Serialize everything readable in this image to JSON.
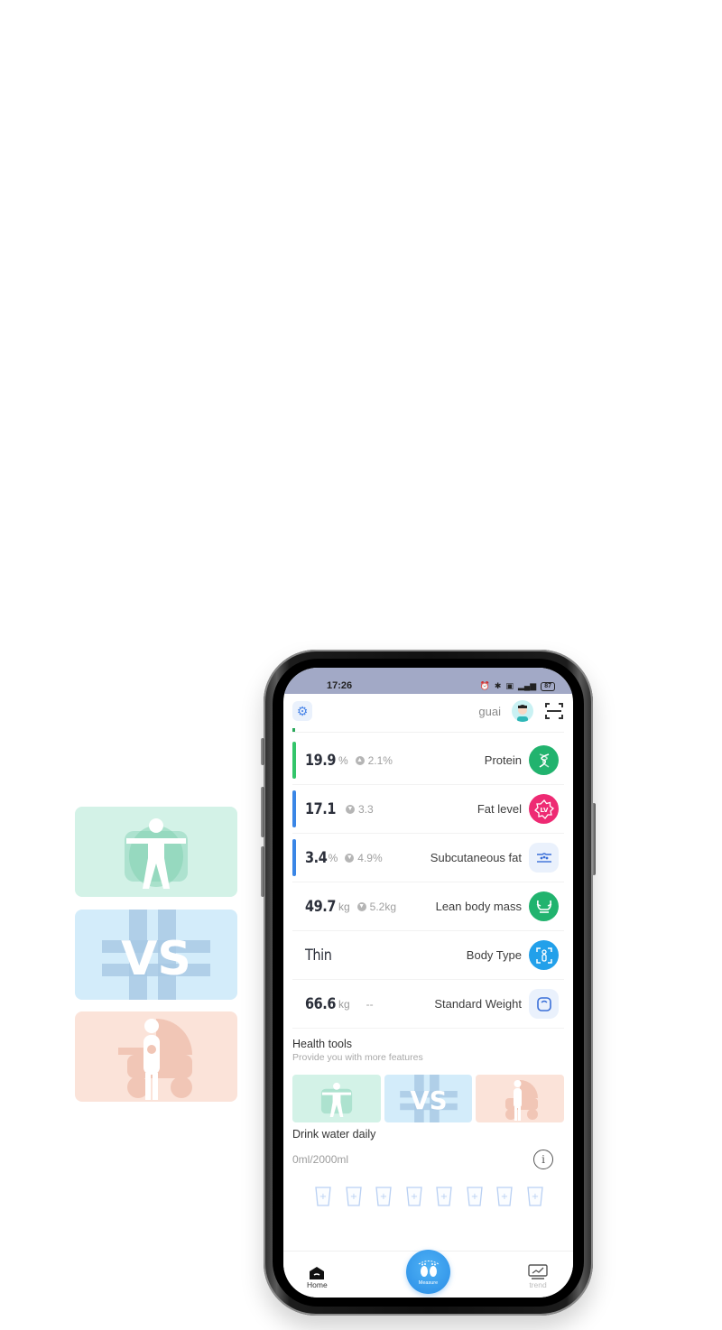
{
  "promo_cards": [
    {
      "name": "body-figure",
      "label": "Body"
    },
    {
      "name": "vs-compare",
      "label": "VS"
    },
    {
      "name": "baby-stroller",
      "label": "Baby"
    }
  ],
  "status_bar": {
    "time": "17:26",
    "icons": [
      "alarm-icon",
      "bluetooth-icon",
      "hd-icon",
      "signal-icon"
    ],
    "battery": "87"
  },
  "top_bar": {
    "settings_icon": "gear-icon",
    "username": "guai",
    "avatar_icon": "avatar",
    "scan_icon": "scan-icon"
  },
  "metrics": [
    {
      "value": "19.9",
      "unit": "%",
      "delta_dir": "up",
      "delta": "2.1%",
      "label": "Protein",
      "icon": "dna-icon",
      "icon_color": "#21b36e",
      "bar_color": "#33c56a"
    },
    {
      "value": "17.1",
      "unit": "",
      "delta_dir": "down",
      "delta": "3.3",
      "label": "Fat level",
      "icon": "lv-badge-icon",
      "icon_color": "#ee2a73",
      "bar_color": "#3a86e6"
    },
    {
      "value": "3.4",
      "unit": "%",
      "delta_dir": "down",
      "delta": "4.9%",
      "label": "Subcutaneous fat",
      "icon": "subcutaneous-fat-icon",
      "icon_color": "#eaf1fc",
      "bar_color": "#3a86e6"
    },
    {
      "value": "49.7",
      "unit": "kg",
      "delta_dir": "down",
      "delta": "5.2kg",
      "label": "Lean body mass",
      "icon": "muscle-icon",
      "icon_color": "#21b36e",
      "bar_color": ""
    },
    {
      "value": "Thin",
      "unit": "",
      "delta_dir": "",
      "delta": "",
      "label": "Body Type",
      "icon": "body-type-icon",
      "icon_color": "#22a0ea",
      "bar_color": ""
    },
    {
      "value": "66.6",
      "unit": "kg",
      "delta_dir": "",
      "delta": "--",
      "label": "Standard Weight",
      "icon": "scale-icon",
      "icon_color": "#eaf1fc",
      "bar_color": ""
    }
  ],
  "health_tools": {
    "title": "Health tools",
    "subtitle": "Provide you with more features",
    "tools": [
      {
        "name": "body-figure"
      },
      {
        "name": "vs-compare",
        "label": "VS"
      },
      {
        "name": "baby-stroller"
      }
    ]
  },
  "water": {
    "title": "Drink water daily",
    "amount": "0ml/2000ml",
    "info_icon": "i",
    "cups_count": 8,
    "cup_symbol": "+"
  },
  "tab_bar": {
    "home_label": "Home",
    "measure_label": "Measure",
    "trend_label": "trend"
  },
  "colors": {
    "accent_blue": "#2a8de6",
    "protein_green": "#21b36e",
    "fat_pink": "#ee2a73",
    "status_bar_bg": "#a2a9c6"
  }
}
